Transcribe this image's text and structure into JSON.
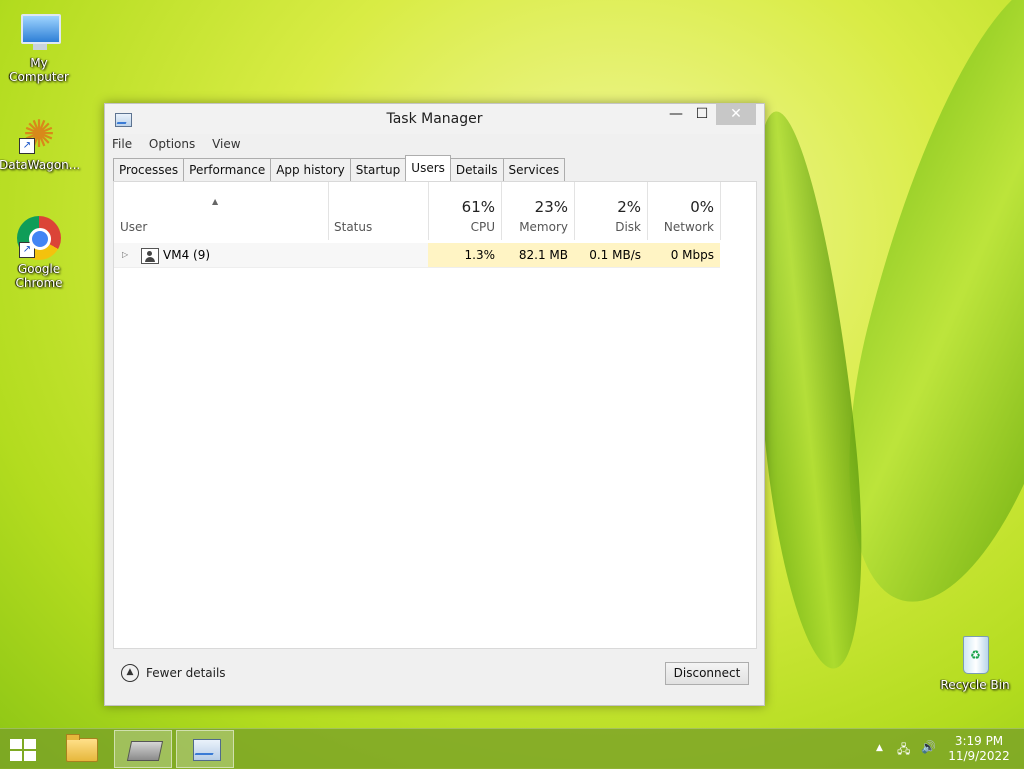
{
  "desktop": {
    "icons": [
      {
        "label": "My Computer"
      },
      {
        "label": "DataWagon..."
      },
      {
        "label": "Google Chrome"
      },
      {
        "label": "Recycle Bin"
      }
    ]
  },
  "window": {
    "title": "Task Manager",
    "controls": {
      "minimize": "—",
      "maximize": "☐",
      "close": "✕"
    },
    "menu": [
      "File",
      "Options",
      "View"
    ],
    "tabs": [
      "Processes",
      "Performance",
      "App history",
      "Startup",
      "Users",
      "Details",
      "Services"
    ],
    "active_tab": "Users",
    "columns": {
      "user": {
        "label": "User"
      },
      "status": {
        "label": "Status"
      },
      "cpu": {
        "pct": "61%",
        "label": "CPU"
      },
      "memory": {
        "pct": "23%",
        "label": "Memory"
      },
      "disk": {
        "pct": "2%",
        "label": "Disk"
      },
      "network": {
        "pct": "0%",
        "label": "Network"
      }
    },
    "rows": [
      {
        "user": "VM4 (9)",
        "status": "",
        "cpu": "1.3%",
        "memory": "82.1 MB",
        "disk": "0.1 MB/s",
        "network": "0 Mbps"
      }
    ],
    "footer": {
      "fewer_details": "Fewer details",
      "disconnect": "Disconnect"
    }
  },
  "taskbar": {
    "clock": {
      "time": "3:19 PM",
      "date": "11/9/2022"
    }
  },
  "colors": {
    "heat_cell": "#fff4c4",
    "taskbar": "#78a028",
    "close_button": "#c7c7c7"
  }
}
